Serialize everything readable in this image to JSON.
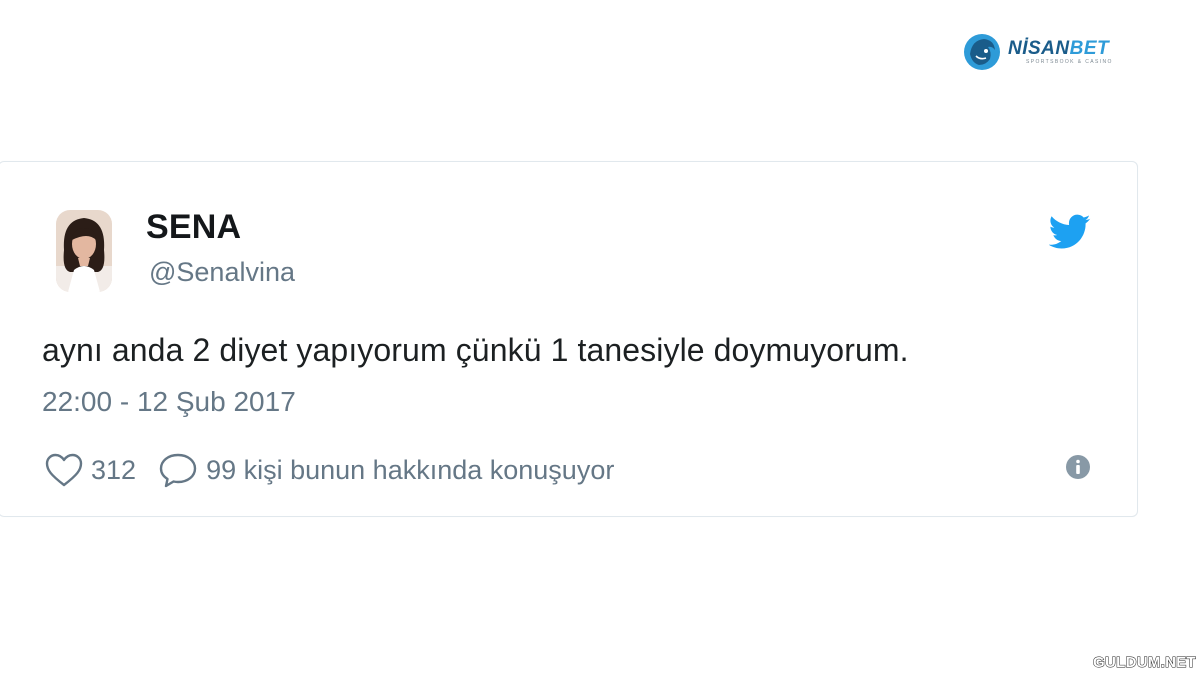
{
  "brand": {
    "name_main": "NİSAN",
    "name_accent": "BET",
    "tagline": "SPORTSBOOK & CASINO",
    "logo_icon": "lion-head-icon",
    "colors": {
      "primary": "#1a5c8a",
      "accent": "#2e9bd8"
    }
  },
  "tweet": {
    "display_name": "SENA",
    "handle": "@Senalvina",
    "text": "aynı anda 2 diyet yapıyorum çünkü 1 tanesiyle doymuyorum.",
    "timestamp": "22:00 - 12 Şub 2017",
    "likes": "312",
    "replies_text": "99 kişi bunun hakkında konuşuyor",
    "icons": {
      "platform": "twitter-bird-icon",
      "like": "heart-icon",
      "reply": "speech-bubble-icon",
      "info": "info-icon"
    },
    "colors": {
      "twitter_blue": "#1da1f2",
      "secondary_text": "#657786",
      "border": "#e1e8ed"
    }
  },
  "watermark": {
    "text": "GULDUM.NET"
  }
}
